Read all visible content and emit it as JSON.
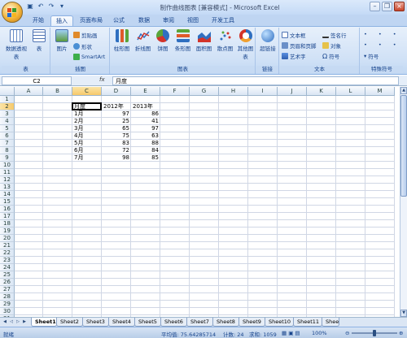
{
  "window": {
    "title": "制作曲线图表 [兼容模式] - Microsoft Excel",
    "controls": [
      "minimize",
      "restore",
      "close"
    ]
  },
  "ribbon_tabs": [
    "开始",
    "插入",
    "页面布局",
    "公式",
    "数据",
    "审阅",
    "视图",
    "开发工具"
  ],
  "active_tab": "插入",
  "ribbon": {
    "groups": [
      {
        "label": "表",
        "items": [
          "数据透视表",
          "表"
        ]
      },
      {
        "label": "插图",
        "items": [
          "图片",
          "剪贴画",
          "形状",
          "SmartArt"
        ]
      },
      {
        "label": "图表",
        "items": [
          "柱形图",
          "折线图",
          "饼图",
          "条形图",
          "面积图",
          "散点图",
          "其他图表"
        ]
      },
      {
        "label": "链接",
        "items": [
          "超链接"
        ]
      },
      {
        "label": "文本",
        "items": [
          "文本框",
          "页眉和页脚",
          "艺术字",
          "签名行",
          "对象",
          "符号"
        ]
      },
      {
        "label": "特殊符号",
        "items": [
          "符号"
        ]
      }
    ]
  },
  "formula_bar": {
    "name_box": "C2",
    "fx": "fx",
    "value": "月度"
  },
  "columns": [
    "A",
    "B",
    "C",
    "D",
    "E",
    "F",
    "G",
    "H",
    "I",
    "J",
    "K",
    "L",
    "M"
  ],
  "rows": [
    "1",
    "2",
    "3",
    "4",
    "5",
    "6",
    "7",
    "8",
    "9",
    "10",
    "11",
    "12",
    "13",
    "14",
    "15",
    "16",
    "17",
    "18",
    "19",
    "20",
    "21",
    "22",
    "23",
    "24",
    "25",
    "26",
    "27",
    "28",
    "29",
    "30",
    "31",
    "32"
  ],
  "table": {
    "headers": [
      "月度",
      "2012年",
      "2013年"
    ],
    "rows": [
      [
        "1月",
        "97",
        "86"
      ],
      [
        "2月",
        "25",
        "41"
      ],
      [
        "3月",
        "65",
        "97"
      ],
      [
        "4月",
        "75",
        "63"
      ],
      [
        "5月",
        "83",
        "88"
      ],
      [
        "6月",
        "72",
        "84"
      ],
      [
        "7月",
        "98",
        "85"
      ]
    ]
  },
  "sheet_tabs": [
    "Sheet1",
    "Sheet2",
    "Sheet3",
    "Sheet4",
    "Sheet5",
    "Sheet6",
    "Sheet7",
    "Sheet8",
    "Sheet9",
    "Sheet10",
    "Sheet11",
    "Shee"
  ],
  "active_sheet": "Sheet1",
  "status": {
    "mode": "就绪",
    "average": "平均值: 75.64285714",
    "count": "计数: 24",
    "sum": "求和: 1059",
    "zoom": "100%"
  },
  "colors": {
    "ribbon": "#d0e1f6",
    "selection_border": "#000000",
    "header_selected": "#f6c96b"
  }
}
